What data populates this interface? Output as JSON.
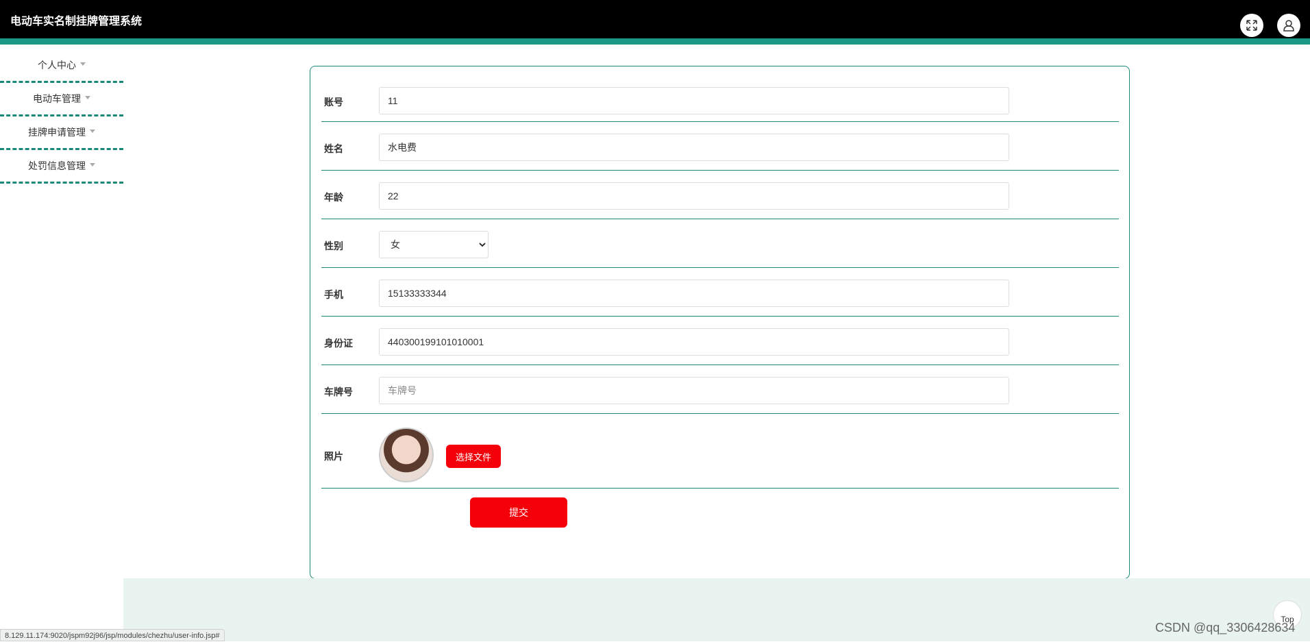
{
  "header": {
    "title": "电动车实名制挂牌管理系统",
    "fullscreen_icon": "expand-icon",
    "user_icon": "user-icon"
  },
  "sidebar": {
    "items": [
      {
        "label": "个人中心"
      },
      {
        "label": "电动车管理"
      },
      {
        "label": "挂牌申请管理"
      },
      {
        "label": "处罚信息管理"
      }
    ]
  },
  "form": {
    "account": {
      "label": "账号",
      "value": "11"
    },
    "name": {
      "label": "姓名",
      "value": "水电费"
    },
    "age": {
      "label": "年龄",
      "value": "22"
    },
    "gender": {
      "label": "性别",
      "value": "女"
    },
    "phone": {
      "label": "手机",
      "value": "15133333344"
    },
    "id_card": {
      "label": "身份证",
      "value": "440300199101010001"
    },
    "plate": {
      "label": "车牌号",
      "value": "",
      "placeholder": "车牌号"
    },
    "photo": {
      "label": "照片",
      "file_button": "选择文件"
    },
    "submit": "提交"
  },
  "status_bar": {
    "url": "8.129.11.174:9020/jspm92j96/jsp/modules/chezhu/user-info.jsp#"
  },
  "top_button": "Top",
  "watermark": "CSDN @qq_3306428634",
  "colors": {
    "header_bg": "#000000",
    "accent": "#1a9986",
    "button_red": "#f5000a"
  }
}
